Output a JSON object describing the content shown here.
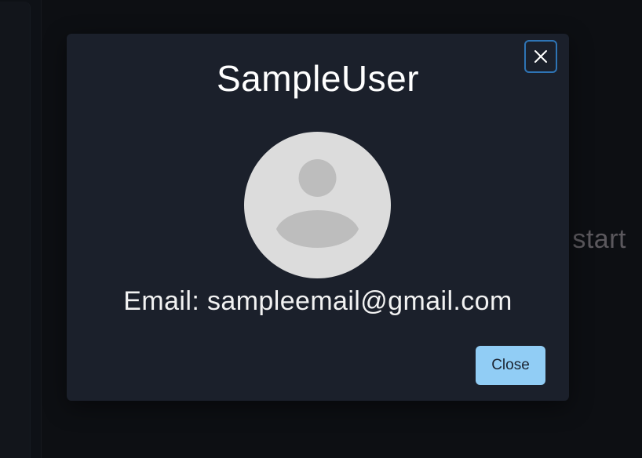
{
  "background": {
    "partial_text": "o start"
  },
  "modal": {
    "title": "SampleUser",
    "email_line": "Email: sampleemail@gmail.com",
    "close_button_label": "Close",
    "close_icon": "close-icon",
    "avatar_icon": "user-avatar-placeholder-icon"
  },
  "colors": {
    "modal_bg": "#1b202b",
    "page_bg": "#12151b",
    "close_button_bg": "#91cdf5",
    "close_x_border": "#2e74b5",
    "avatar_bg": "#dcdcdc",
    "avatar_figure": "#bdbdbd"
  }
}
